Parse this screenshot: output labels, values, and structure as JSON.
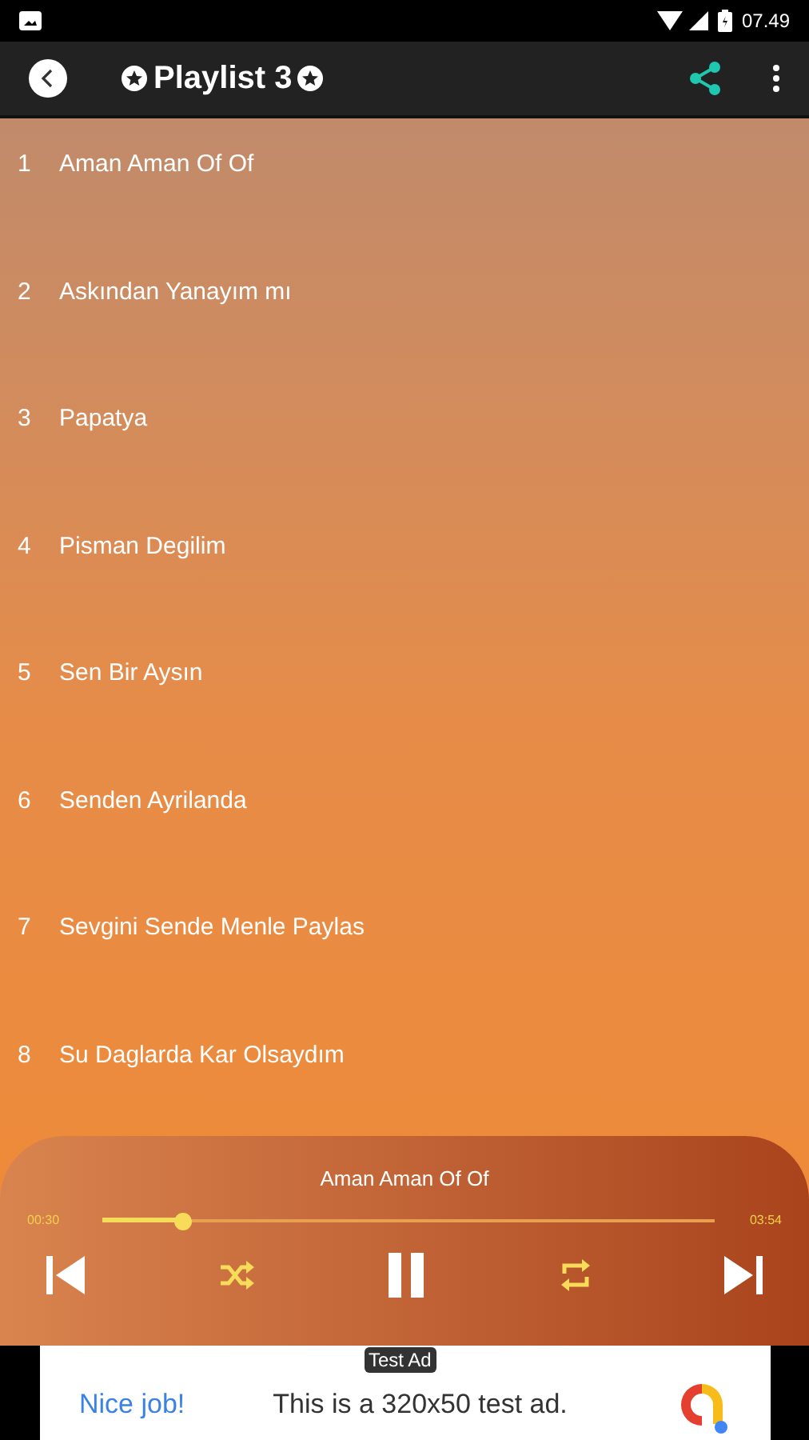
{
  "status_bar": {
    "time": "07.49"
  },
  "toolbar": {
    "title": "Playlist 3"
  },
  "tracks": [
    {
      "number": "1",
      "title": "Aman Aman Of Of"
    },
    {
      "number": "2",
      "title": "Askından Yanayım mı"
    },
    {
      "number": "3",
      "title": "Papatya"
    },
    {
      "number": "4",
      "title": "Pisman Degilim"
    },
    {
      "number": "5",
      "title": "Sen Bir Aysın"
    },
    {
      "number": "6",
      "title": "Senden Ayrilanda"
    },
    {
      "number": "7",
      "title": "Sevgini Sende Menle Paylas"
    },
    {
      "number": "8",
      "title": "Su Daglarda Kar Olsaydım"
    }
  ],
  "player": {
    "now_playing": "Aman Aman Of Of",
    "elapsed": "00:30",
    "duration": "03:54",
    "level": 0.13,
    "playing": true
  },
  "ad": {
    "badge": "Test Ad",
    "headline": "Nice job!",
    "text": "This is a 320x50 test ad."
  }
}
